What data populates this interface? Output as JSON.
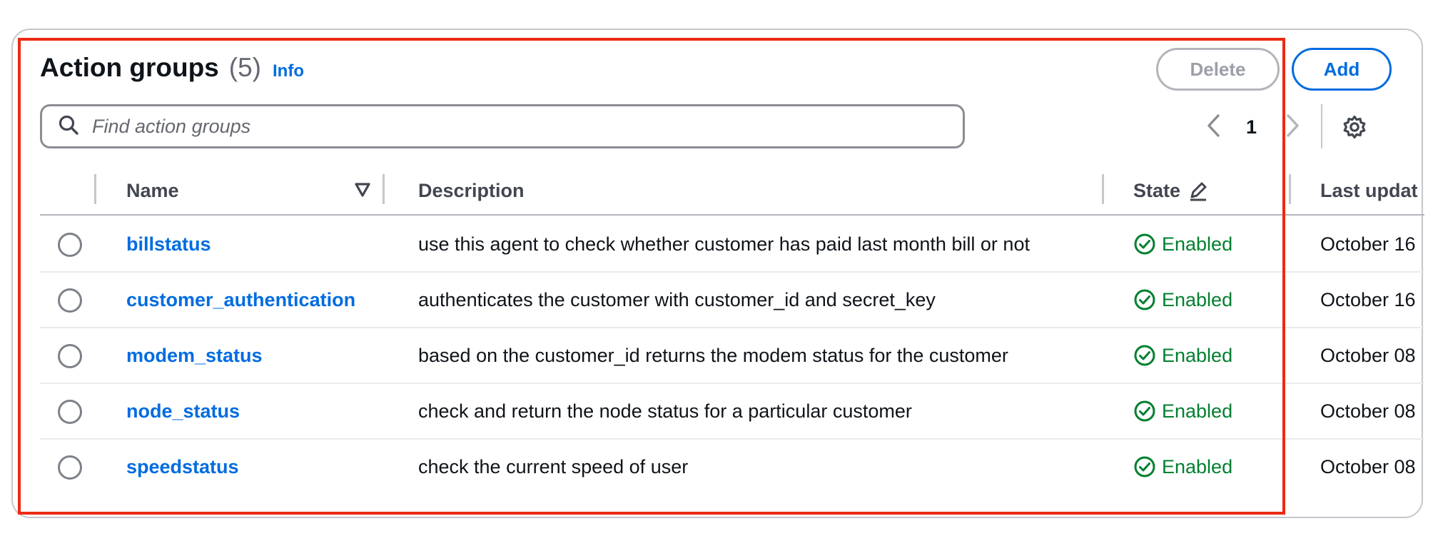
{
  "header": {
    "title": "Action groups",
    "count": "(5)",
    "info_label": "Info",
    "delete_label": "Delete",
    "add_label": "Add"
  },
  "search": {
    "placeholder": "Find action groups",
    "value": ""
  },
  "pagination": {
    "current_page": "1"
  },
  "table": {
    "columns": {
      "name": "Name",
      "description": "Description",
      "state": "State",
      "last_updated": "Last updat"
    },
    "rows": [
      {
        "name": "billstatus",
        "description": "use this agent to check whether customer has paid last month bill or not",
        "state": "Enabled",
        "last_updated": "October 16"
      },
      {
        "name": "customer_authentication",
        "description": "authenticates the customer with customer_id and secret_key",
        "state": "Enabled",
        "last_updated": "October 16"
      },
      {
        "name": "modem_status",
        "description": "based on the customer_id returns the modem status for the customer",
        "state": "Enabled",
        "last_updated": "October 08"
      },
      {
        "name": "node_status",
        "description": "check and return the node status for a particular customer",
        "state": "Enabled",
        "last_updated": "October 08"
      },
      {
        "name": "speedstatus",
        "description": "check the current speed of user",
        "state": "Enabled",
        "last_updated": "October 08"
      }
    ]
  },
  "colors": {
    "link": "#006ce0",
    "enabled": "#00802f",
    "highlight": "#ec2a12"
  },
  "icons": {
    "search": "search-icon",
    "prev": "chevron-left-icon",
    "next": "chevron-right-icon",
    "settings": "gear-icon",
    "sort": "sort-down-icon",
    "edit": "pencil-icon",
    "status": "check-circle-icon"
  }
}
